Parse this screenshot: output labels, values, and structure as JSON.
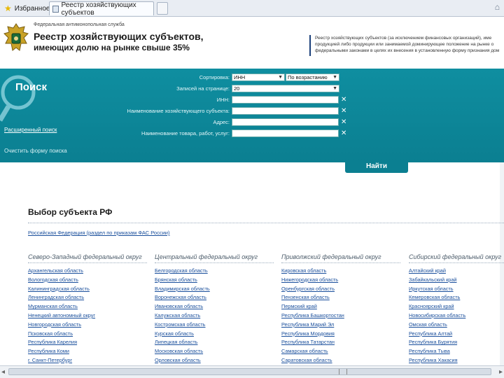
{
  "browser": {
    "favorites_label": "Избранное",
    "tab_title": "Реестр хозяйствующих субъектов",
    "tab_icon": "page-icon",
    "favorites_icon": "star-icon"
  },
  "header": {
    "agency": "Федеральная антимонопольная служба",
    "title_line1": "Реестр хозяйствующих субъектов,",
    "title_line2": "имеющих долю на рынке свыше 35%",
    "notice_line1": "Реестр хозяйствующих субъектов (за исключением финансовых организаций), име",
    "notice_line2": "продукцией либо продукции или занимаемой доминирующее положение на рынке о",
    "notice_line3": "федеральными законами в целях их внесения в установленную форму признания дом"
  },
  "search": {
    "title": "Поиск",
    "sort_label": "Сортировка:",
    "sort_value": "ИНН",
    "sort_order": "По возрастанию",
    "per_page_label": "Записей на странице:",
    "per_page_value": "20",
    "inn_label": "ИНН:",
    "name_label": "Наименование хозяйствующего субъекта:",
    "address_label": "Адрес:",
    "goods_label": "Наименование товара, работ, услуг:",
    "advanced_link": "Расширенный поиск",
    "clear_link": "Очистить форму поиска",
    "submit": "Найти"
  },
  "regions": {
    "title": "Выбор субъекта РФ",
    "rf_link": "Российская Федерация (раздел по приказам ФАС России)",
    "columns": [
      {
        "header": "Северо-Западный федеральный округ",
        "items": [
          "Архангельская область",
          "Вологодская область",
          "Калининградская область",
          "Ленинградская область",
          "Мурманская область",
          "Ненецкий автономный округ",
          "Новгородская область",
          "Псковская область",
          "Республика Карелия",
          "Республика Коми",
          "г. Санкт-Петербург"
        ]
      },
      {
        "header": "Центральный федеральный округ",
        "items": [
          "Белгородская область",
          "Брянская область",
          "Владимирская область",
          "Воронежская область",
          "Ивановская область",
          "Калужская область",
          "Костромская область",
          "Курская область",
          "Липецкая область",
          "Московская область",
          "Орловская область"
        ]
      },
      {
        "header": "Приволжский федеральный округ",
        "items": [
          "Кировская область",
          "Нижегородская область",
          "Оренбургская область",
          "Пензенская область",
          "Пермский край",
          "Республика Башкортостан",
          "Республика Марий Эл",
          "Республика Мордовия",
          "Республика Татарстан",
          "Самарская область",
          "Саратовская область"
        ]
      },
      {
        "header": "Сибирский федеральный округ",
        "items": [
          "Алтайский край",
          "Забайкальский край",
          "Иркутская область",
          "Кемеровская область",
          "Красноярский край",
          "Новосибирская область",
          "Омская область",
          "Республика Алтай",
          "Республика Бурятия",
          "Республика Тыва",
          "Республика Хакасия"
        ]
      }
    ]
  },
  "colors": {
    "panel": "#0b7f91",
    "link": "#1a4f9c",
    "header_rule": "#1b3f7a"
  }
}
